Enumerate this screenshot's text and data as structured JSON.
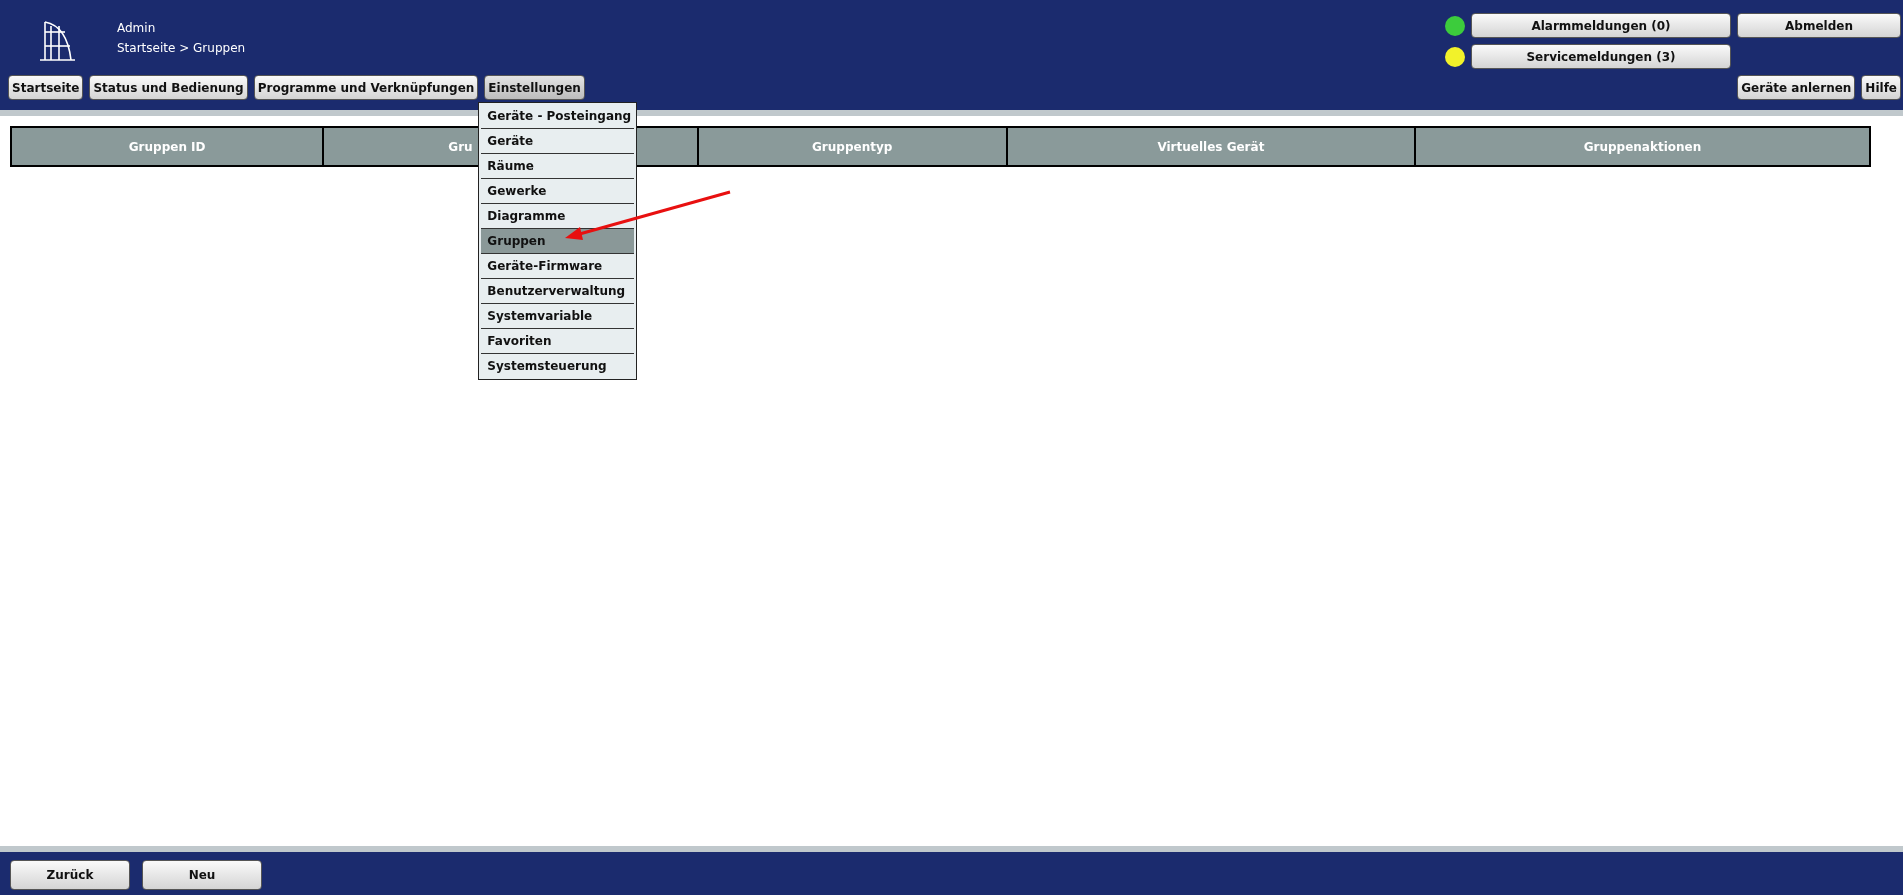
{
  "header": {
    "user": "Admin",
    "breadcrumb": "Startseite > Gruppen"
  },
  "nav": [
    {
      "label": "Startseite",
      "expanded": false
    },
    {
      "label": "Status und Bedienung",
      "expanded": false
    },
    {
      "label": "Programme und Verknüpfungen",
      "expanded": false
    },
    {
      "label": "Einstellungen",
      "expanded": true
    }
  ],
  "alerts": [
    {
      "label": "Alarmmeldungen (0)",
      "color": "#3ccc3c"
    },
    {
      "label": "Servicemeldungen (3)",
      "color": "#f2f22a"
    }
  ],
  "logout": "Abmelden",
  "right_buttons": [
    "Geräte anlernen",
    "Hilfe"
  ],
  "menu": {
    "items": [
      {
        "label": "Geräte - Posteingang",
        "selected": false
      },
      {
        "label": "Geräte",
        "selected": false
      },
      {
        "label": "Räume",
        "selected": false
      },
      {
        "label": "Gewerke",
        "selected": false
      },
      {
        "label": "Diagramme",
        "selected": false
      },
      {
        "label": "Gruppen",
        "selected": true
      },
      {
        "label": "Geräte-Firmware",
        "selected": false
      },
      {
        "label": "Benutzerverwaltung",
        "selected": false
      },
      {
        "label": "Systemvariable",
        "selected": false
      },
      {
        "label": "Favoriten",
        "selected": false
      },
      {
        "label": "Systemsteuerung",
        "selected": false
      }
    ]
  },
  "table": {
    "columns": [
      "Gruppen ID",
      "Gru",
      "Gruppentyp",
      "Virtuelles Gerät",
      "Gruppenaktionen"
    ]
  },
  "footer_buttons": [
    "Zurück",
    "Neu"
  ]
}
